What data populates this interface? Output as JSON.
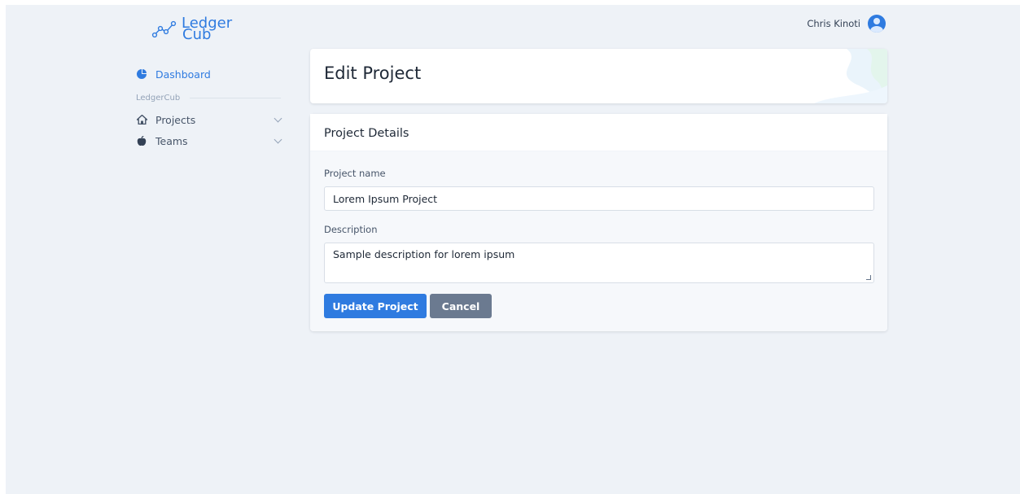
{
  "brand": {
    "line1": "Ledger",
    "line2": "Cub",
    "color": "#2f7be0"
  },
  "user": {
    "name": "Chris Kinoti"
  },
  "sidebar": {
    "dashboard": {
      "label": "Dashboard",
      "icon": "pie-chart-icon"
    },
    "section_label": "LedgerCub",
    "items": [
      {
        "label": "Projects",
        "icon": "house-icon"
      },
      {
        "label": "Teams",
        "icon": "apple-icon"
      }
    ]
  },
  "page": {
    "title": "Edit Project"
  },
  "form": {
    "card_title": "Project Details",
    "name_label": "Project name",
    "name_value": "Lorem Ipsum Project",
    "description_label": "Description",
    "description_value": "Sample description for lorem ipsum",
    "update_label": "Update Project",
    "cancel_label": "Cancel"
  },
  "colors": {
    "accent": "#2f7be0",
    "secondary": "#6b7a90",
    "background": "#eef2f7"
  }
}
